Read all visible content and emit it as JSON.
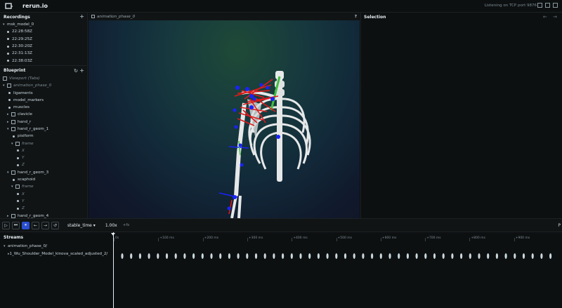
{
  "app": {
    "title": "rerun.io",
    "status": "Listening on TCP port 9876"
  },
  "recordings": {
    "header": "Recordings",
    "app_id": "msk_model_0",
    "items": [
      "22:28:58Z",
      "22:29:25Z",
      "22:30:20Z",
      "22:31:13Z",
      "22:38:03Z"
    ]
  },
  "blueprint": {
    "header": "Blueprint",
    "viewport": "Viewport (Tabs)",
    "view": "animation_phase_0",
    "items": [
      {
        "label": "ligaments",
        "kind": "leaf",
        "indent": 1
      },
      {
        "label": "model_markers",
        "kind": "leaf",
        "indent": 1
      },
      {
        "label": "muscles",
        "kind": "leaf",
        "indent": 1
      },
      {
        "label": "clavicle",
        "kind": "group",
        "indent": 1,
        "caret": "▸"
      },
      {
        "label": "hand_r",
        "kind": "group",
        "indent": 1,
        "caret": "▸"
      },
      {
        "label": "hand_r_geom_1",
        "kind": "group",
        "indent": 1,
        "caret": "▾"
      },
      {
        "label": "pisiform",
        "kind": "leaf",
        "indent": 2
      },
      {
        "label": "frame",
        "kind": "group-dim",
        "indent": 2,
        "caret": "▾"
      },
      {
        "label": "X",
        "kind": "leaf-dim",
        "indent": 3
      },
      {
        "label": "Y",
        "kind": "leaf-dim",
        "indent": 3
      },
      {
        "label": "Z",
        "kind": "leaf-dim",
        "indent": 3
      },
      {
        "label": "hand_r_geom_3",
        "kind": "group",
        "indent": 1,
        "caret": "▾"
      },
      {
        "label": "scaphoid",
        "kind": "leaf",
        "indent": 2
      },
      {
        "label": "frame",
        "kind": "group-dim",
        "indent": 2,
        "caret": "▾"
      },
      {
        "label": "X",
        "kind": "leaf-dim",
        "indent": 3
      },
      {
        "label": "Y",
        "kind": "leaf-dim",
        "indent": 3
      },
      {
        "label": "Z",
        "kind": "leaf-dim",
        "indent": 3
      },
      {
        "label": "hand_r_geom_4",
        "kind": "group",
        "indent": 1,
        "caret": "▸"
      }
    ]
  },
  "viewport": {
    "tab": "animation_phase_0",
    "help": "?"
  },
  "selection": {
    "header": "Selection",
    "nav": "← →"
  },
  "timeline": {
    "controls": [
      "▷",
      "⏭",
      "⏸",
      "←",
      "→",
      "↺"
    ],
    "timeline_name": "stable_time",
    "speed": "1.00x",
    "fps": "+fs",
    "ticks": [
      "0s",
      "+100 ms",
      "+200 ms",
      "+300 ms",
      "+400 ms",
      "+500 ms",
      "+600 ms",
      "+700 ms",
      "+800 ms",
      "+900 ms"
    ],
    "pin": "P"
  },
  "streams": {
    "header": "Streams",
    "root": "animation_phase_0/",
    "child": "1_Wu_Shoulder_Model_kinova_scaled_adjusted_2/"
  },
  "colors": {
    "accent": "#2a4fd0",
    "muscle": "#e01a1a",
    "marker": "#1a22ff",
    "bone": "#e6e8e8",
    "tendon": "#3fbf3f"
  }
}
